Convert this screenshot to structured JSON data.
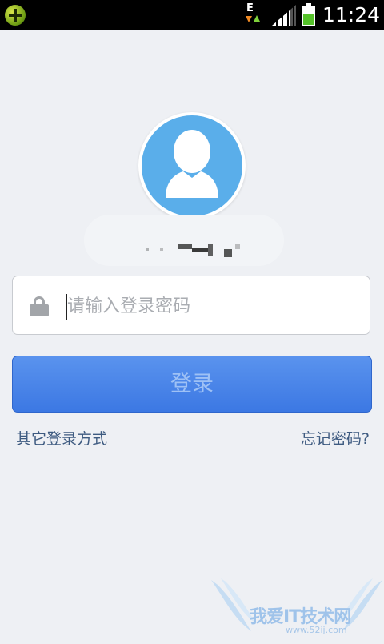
{
  "status_bar": {
    "network_type": "E",
    "time": "11:24",
    "signal_level": 0.75,
    "battery_level": 0.6,
    "colors": {
      "battery_fill": "#55c22a",
      "upload_arrow": "#7fd13b",
      "download_arrow": "#f08a24"
    }
  },
  "login": {
    "avatar_icon": "user-silhouette-icon",
    "username": "",
    "password_placeholder": "请输入登录密码",
    "password_value": "",
    "lock_icon": "lock-icon",
    "login_button": "登录",
    "other_login": "其它登录方式",
    "forgot_password": "忘记密码?"
  },
  "watermark": {
    "text": "我爱IT技术网",
    "url": "www.52ij.com"
  },
  "colors": {
    "background": "#eef0f4",
    "avatar": "#5aaeea",
    "button": "#3c78e3",
    "button_text": "#9ec1f5",
    "link": "#3d5a80"
  }
}
